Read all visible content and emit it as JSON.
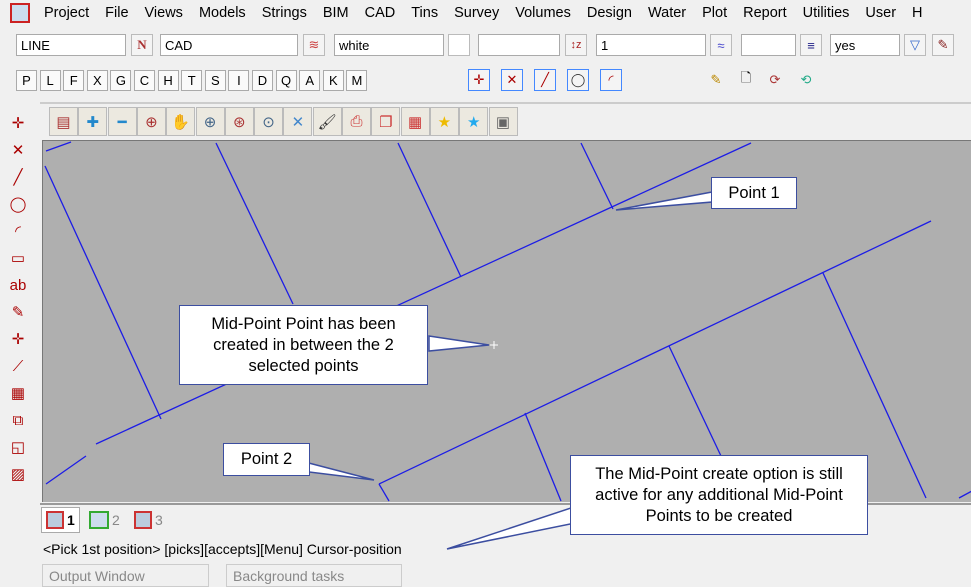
{
  "menu": [
    "Project",
    "File",
    "Views",
    "Models",
    "Strings",
    "BIM",
    "CAD",
    "Tins",
    "Survey",
    "Volumes",
    "Design",
    "Water",
    "Plot",
    "Report",
    "Utilities",
    "User",
    "H"
  ],
  "toolbar": {
    "string_type": "LINE",
    "name_btn": "N",
    "model": "CAD",
    "colour": "white",
    "style": "",
    "weight": "1",
    "extra": "",
    "visible": "yes"
  },
  "letters": [
    "P",
    "L",
    "F",
    "X",
    "G",
    "C",
    "H",
    "T",
    "S",
    "I",
    "D",
    "Q",
    "A",
    "K",
    "M"
  ],
  "view_tabs": [
    {
      "label": "1"
    },
    {
      "label": "2"
    },
    {
      "label": "3"
    }
  ],
  "status": "<Pick 1st position> [picks][accepts][Menu] Cursor-position",
  "panes": [
    "Output Window",
    "Background tasks"
  ],
  "callouts": {
    "point1": "Point 1",
    "point2": "Point 2",
    "midpoint": "Mid-Point Point has been created in between the 2 selected points",
    "active": "The Mid-Point create option is still active for any additional Mid-Point Points to be created"
  },
  "colors": {
    "line": "#1c1ce6",
    "canvas": "#afafaf",
    "callout_border": "#3c4ea0"
  }
}
